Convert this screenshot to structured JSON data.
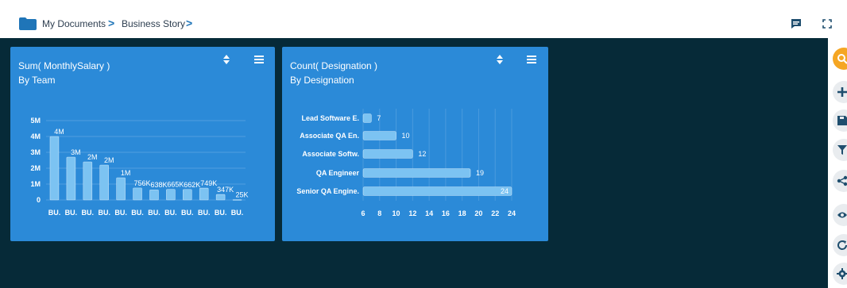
{
  "breadcrumb": {
    "items": [
      {
        "label": "My Documents"
      },
      {
        "label": "Business Story"
      }
    ],
    "separator": ">"
  },
  "toolbar": {
    "icons": [
      "comment-icon",
      "fullscreen-icon"
    ]
  },
  "rail": {
    "icons": [
      "search-icon",
      "plus-icon",
      "save-icon",
      "filter-icon",
      "share-icon",
      "eye-icon",
      "refresh-icon",
      "settings-icon"
    ],
    "active_color": "#f5a623"
  },
  "colors": {
    "card": "#2b8ad8",
    "bar_fill": "#7cc3f2",
    "workspace": "#062a38",
    "folder": "#1f75b8"
  },
  "cards": [
    {
      "title": "Sum( MonthlySalary )",
      "subtitle": "By Team",
      "chart_data": {
        "type": "bar",
        "orientation": "vertical",
        "categories": [
          "BU.",
          "BU.",
          "BU.",
          "BU.",
          "BU.",
          "BU.",
          "BU.",
          "BU.",
          "BU.",
          "BU.",
          "BU.",
          "BU."
        ],
        "values": [
          4000000,
          2700000,
          2400000,
          2200000,
          1400000,
          756000,
          638000,
          665000,
          662000,
          749000,
          347000,
          25000
        ],
        "data_labels": [
          "4M",
          "3M",
          "2M",
          "2M",
          "1M",
          "756K",
          "638K",
          "665K",
          "662K",
          "749K",
          "347K",
          "25K"
        ],
        "y_ticks": [
          "0",
          "1M",
          "2M",
          "3M",
          "4M",
          "5M"
        ],
        "ylim": [
          0,
          5000000
        ],
        "grid": true
      }
    },
    {
      "title": "Count( Designation )",
      "subtitle": "By Designation",
      "chart_data": {
        "type": "bar",
        "orientation": "horizontal",
        "categories": [
          "Lead Software E.",
          "Associate QA En.",
          "Associate Softw.",
          "QA Engineer",
          "Senior QA Engine."
        ],
        "values": [
          7,
          10,
          12,
          19,
          24
        ],
        "data_labels": [
          "7",
          "10",
          "12",
          "19",
          "24"
        ],
        "x_ticks": [
          "6",
          "8",
          "10",
          "12",
          "14",
          "16",
          "18",
          "20",
          "22",
          "24"
        ],
        "xlim": [
          6,
          24
        ],
        "grid": true
      }
    }
  ]
}
